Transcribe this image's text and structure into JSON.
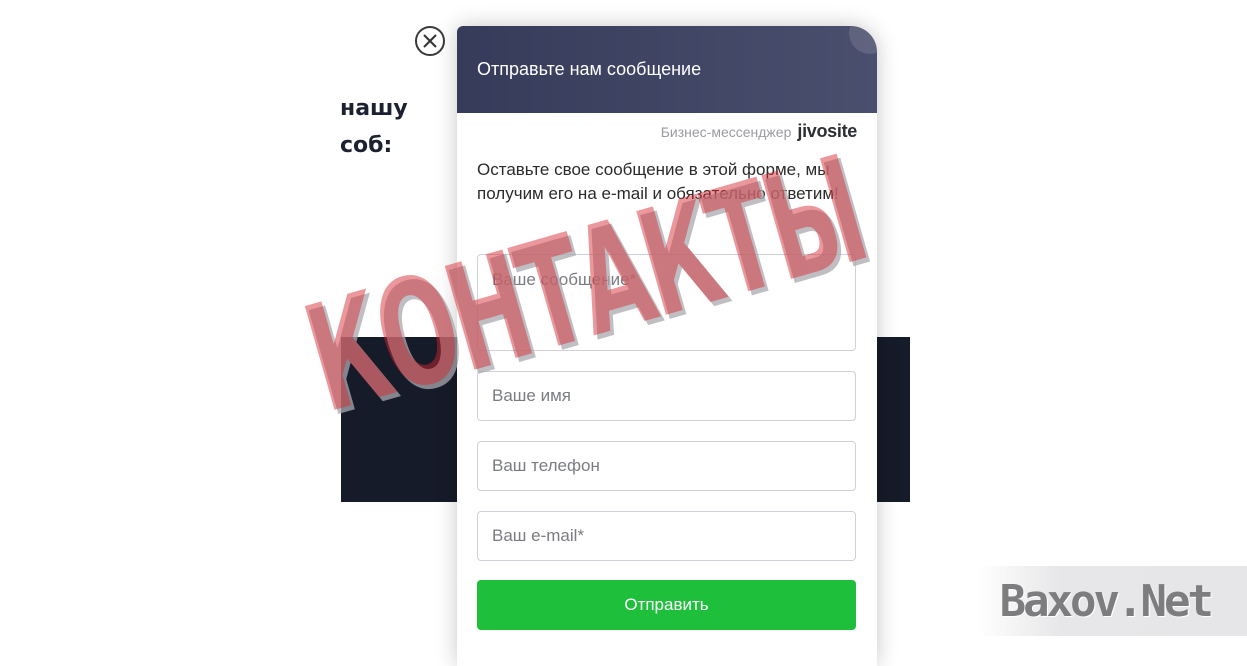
{
  "background": {
    "line1": "нашу",
    "line2": "соб:"
  },
  "widget": {
    "header_title": "Отправьте нам сообщение",
    "brand_caption": "Бизнес-мессенджер",
    "brand_logo": "jivosite",
    "intro_text": "Оставьте свое сообщение в этой форме, мы получим его на e-mail и обязательно ответим!",
    "fields": {
      "message_placeholder": "Ваше сообщение*",
      "name_placeholder": "Ваше имя",
      "phone_placeholder": "Ваш телефон",
      "email_placeholder": "Ваш e-mail*"
    },
    "send_label": "Отправить",
    "accent_color": "#1dbf3b",
    "header_color": "#363b5a"
  },
  "overlay": {
    "stamp_text": "КОНТАКТЫ",
    "watermark_text": "Baxov.Net"
  },
  "icons": {
    "close": "close-icon"
  }
}
